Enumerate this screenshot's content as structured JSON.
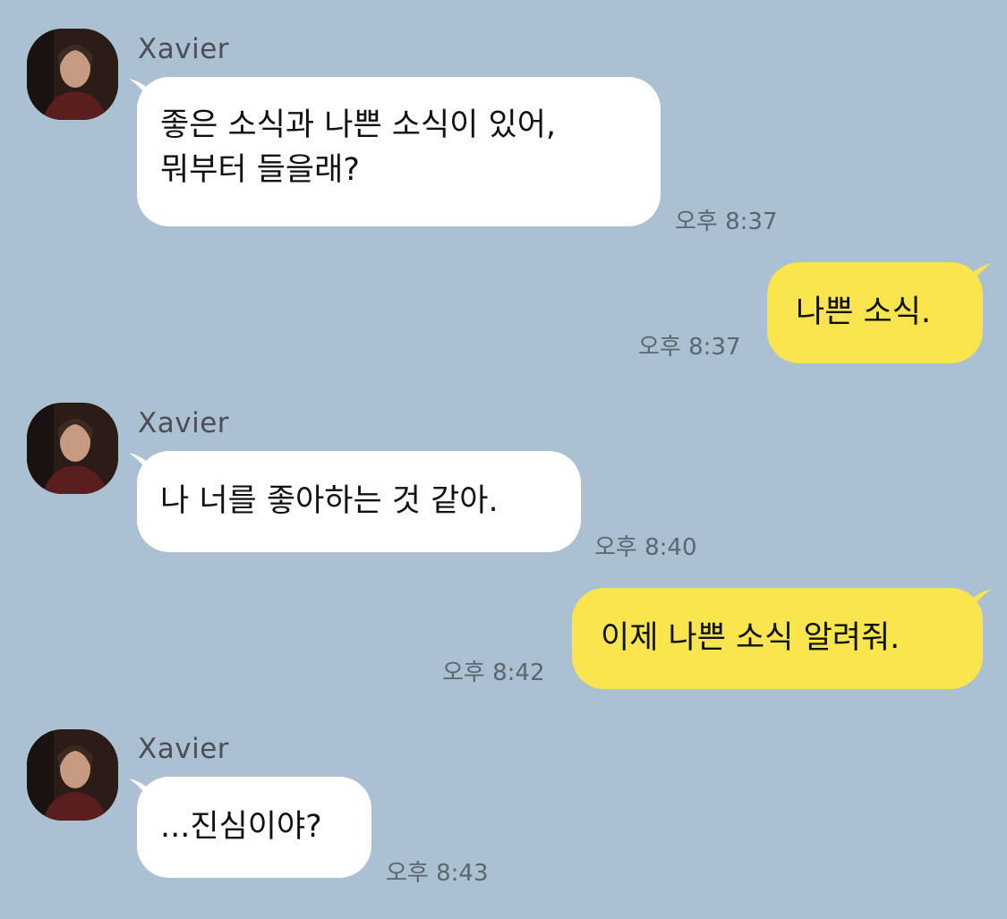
{
  "messages": [
    {
      "direction": "incoming",
      "sender": "Xavier",
      "lines": [
        "좋은 소식과 나쁜 소식이 있어,",
        "뭐부터 들을래?"
      ],
      "time": "오후 8:37"
    },
    {
      "direction": "outgoing",
      "lines": [
        "나쁜 소식."
      ],
      "time": "오후 8:37"
    },
    {
      "direction": "incoming",
      "sender": "Xavier",
      "lines": [
        "나 너를 좋아하는 것 같아."
      ],
      "time": "오후 8:40"
    },
    {
      "direction": "outgoing",
      "lines": [
        "이제 나쁜 소식 알려줘."
      ],
      "time": "오후 8:42"
    },
    {
      "direction": "incoming",
      "sender": "Xavier",
      "lines": [
        "...진심이야?"
      ],
      "time": "오후 8:43"
    }
  ],
  "colors": {
    "background": "#abc0d1",
    "incoming_bubble": "#ffffff",
    "outgoing_bubble": "#f9e54d"
  },
  "icons": {
    "avatar": "profile-photo"
  }
}
